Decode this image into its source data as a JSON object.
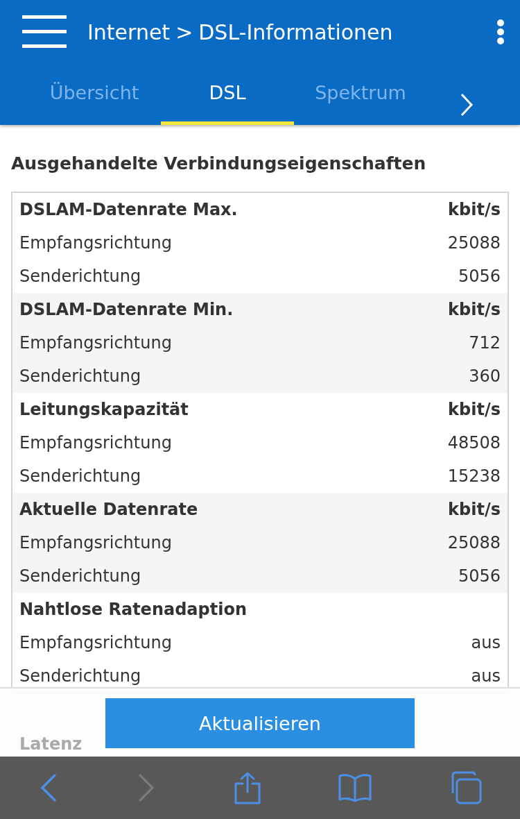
{
  "header": {
    "breadcrumb_parent": "Internet",
    "breadcrumb_separator": ">",
    "title": "DSL-Informationen"
  },
  "tabs": [
    {
      "label": "Übersicht",
      "selected": false
    },
    {
      "label": "DSL",
      "selected": true
    },
    {
      "label": "Spektrum",
      "selected": false
    }
  ],
  "section_title": "Ausgehandelte Verbindungseigenschaften",
  "table": [
    {
      "name": "DSLAM-Datenrate Max.",
      "unit": "kbit/s",
      "rows": [
        {
          "label": "Empfangsrichtung",
          "value": "25088"
        },
        {
          "label": "Senderichtung",
          "value": "5056"
        }
      ]
    },
    {
      "name": "DSLAM-Datenrate Min.",
      "unit": "kbit/s",
      "rows": [
        {
          "label": "Empfangsrichtung",
          "value": "712"
        },
        {
          "label": "Senderichtung",
          "value": "360"
        }
      ]
    },
    {
      "name": "Leitungskapazität",
      "unit": "kbit/s",
      "rows": [
        {
          "label": "Empfangsrichtung",
          "value": "48508"
        },
        {
          "label": "Senderichtung",
          "value": "15238"
        }
      ]
    },
    {
      "name": "Aktuelle Datenrate",
      "unit": "kbit/s",
      "rows": [
        {
          "label": "Empfangsrichtung",
          "value": "25088"
        },
        {
          "label": "Senderichtung",
          "value": "5056"
        }
      ]
    },
    {
      "name": "Nahtlose Ratenadaption",
      "rows": [
        {
          "label": "Empfangsrichtung",
          "value": "aus"
        },
        {
          "label": "Senderichtung",
          "value": "aus"
        }
      ]
    }
  ],
  "next_section": "Latenz",
  "refresh_button": "Aktualisieren",
  "browser_toolbar": [
    {
      "kind": "back",
      "disabled": false
    },
    {
      "kind": "forward",
      "disabled": true
    },
    {
      "kind": "share",
      "disabled": false
    },
    {
      "kind": "bookmarks",
      "disabled": false
    },
    {
      "kind": "tabs",
      "disabled": false
    }
  ]
}
